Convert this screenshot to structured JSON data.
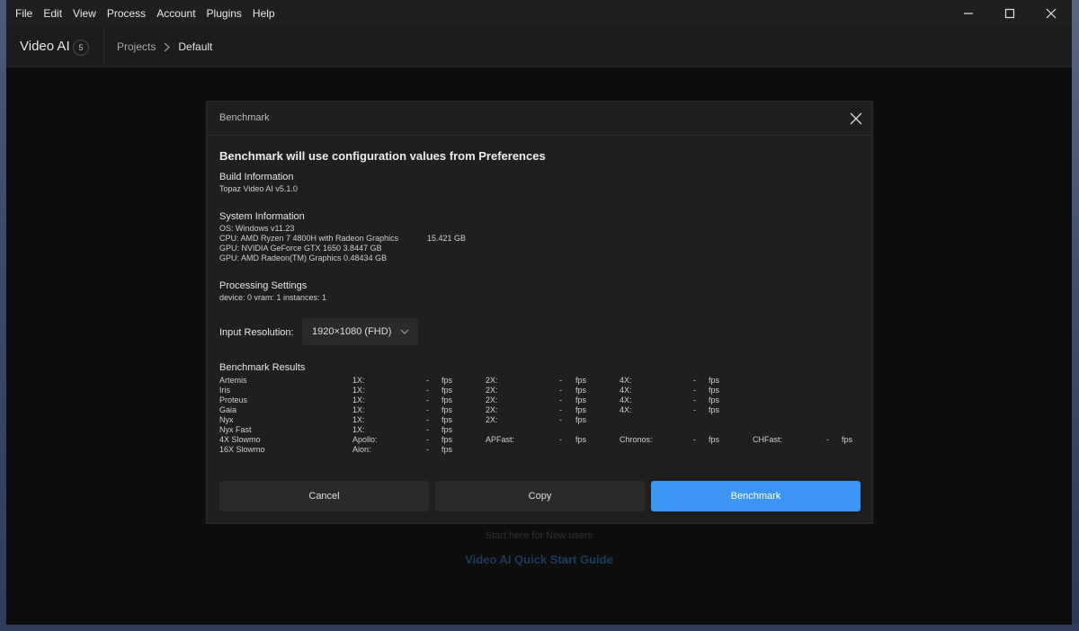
{
  "menubar": {
    "items": [
      "File",
      "Edit",
      "View",
      "Process",
      "Account",
      "Plugins",
      "Help"
    ]
  },
  "window_controls": [
    "minimize-icon",
    "maximize-icon",
    "close-icon"
  ],
  "header": {
    "app_title": "Video AI",
    "badge": "5",
    "breadcrumb": {
      "projects": "Projects",
      "current": "Default"
    }
  },
  "workspace": {
    "hint": "Start here for New users",
    "link": "Video AI Quick Start Guide"
  },
  "dialog": {
    "title": "Benchmark",
    "heading": "Benchmark will use configuration values from Preferences",
    "build": {
      "title": "Build Information",
      "version": "Topaz Video AI v5.1.0"
    },
    "system": {
      "title": "System Information",
      "os": "OS: Windows v11.23",
      "cpu": "CPU: AMD Ryzen 7 4800H with Radeon Graphics",
      "ram": "15.421 GB",
      "gpu1": "GPU: NVIDIA GeForce GTX 1650  3.8447 GB",
      "gpu2": "GPU: AMD Radeon(TM) Graphics  0.48434 GB"
    },
    "processing": {
      "title": "Processing Settings",
      "line": "device: 0 vram: 1 instances: 1"
    },
    "input_resolution": {
      "label": "Input Resolution:",
      "value": "1920×1080 (FHD)"
    },
    "results": {
      "title": "Benchmark Results",
      "unit": "fps",
      "rows": [
        {
          "model": "Artemis",
          "cells": [
            {
              "label": "1X:",
              "value": "-"
            },
            {
              "label": "2X:",
              "value": "-"
            },
            {
              "label": "4X:",
              "value": "-"
            }
          ]
        },
        {
          "model": "Iris",
          "cells": [
            {
              "label": "1X:",
              "value": "-"
            },
            {
              "label": "2X:",
              "value": "-"
            },
            {
              "label": "4X:",
              "value": "-"
            }
          ]
        },
        {
          "model": "Proteus",
          "cells": [
            {
              "label": "1X:",
              "value": "-"
            },
            {
              "label": "2X:",
              "value": "-"
            },
            {
              "label": "4X:",
              "value": "-"
            }
          ]
        },
        {
          "model": "Gaia",
          "cells": [
            {
              "label": "1X:",
              "value": "-"
            },
            {
              "label": "2X:",
              "value": "-"
            },
            {
              "label": "4X:",
              "value": "-"
            }
          ]
        },
        {
          "model": "Nyx",
          "cells": [
            {
              "label": "1X:",
              "value": "-"
            },
            {
              "label": "2X:",
              "value": "-"
            }
          ]
        },
        {
          "model": "Nyx Fast",
          "cells": [
            {
              "label": "1X:",
              "value": "-"
            }
          ]
        },
        {
          "model": "4X Slowmo",
          "cells": [
            {
              "label": "Apollo:",
              "value": "-"
            },
            {
              "label": "APFast:",
              "value": "-"
            },
            {
              "label": "Chronos:",
              "value": "-"
            },
            {
              "label": "CHFast:",
              "value": "-"
            }
          ]
        },
        {
          "model": "16X Slowmo",
          "cells": [
            {
              "label": "Aion:",
              "value": "-"
            }
          ]
        }
      ]
    },
    "buttons": {
      "cancel": "Cancel",
      "copy": "Copy",
      "benchmark": "Benchmark"
    }
  },
  "colors": {
    "accent": "#3d95f5",
    "dialog_bg": "#1f1f1f",
    "app_bg": "#0d0d0d"
  }
}
